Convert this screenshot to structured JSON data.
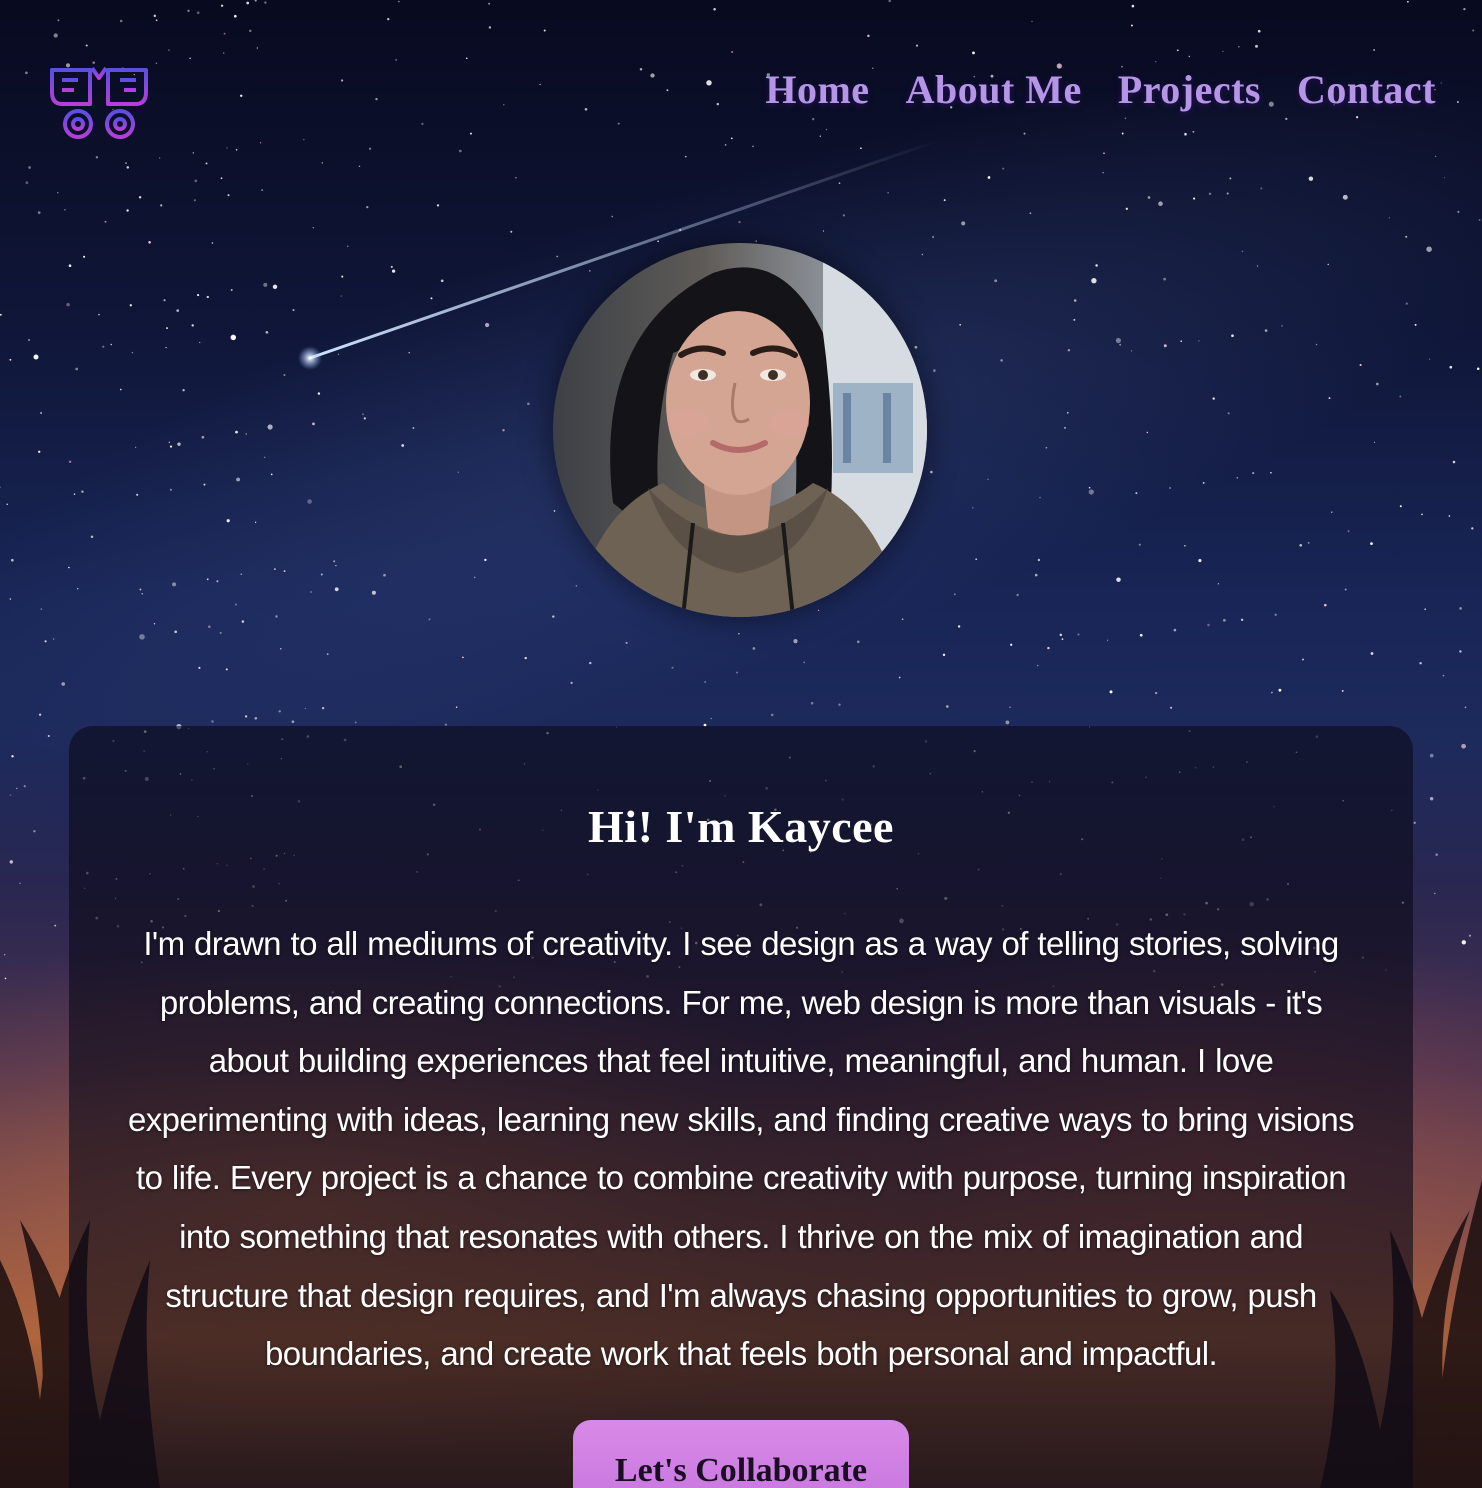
{
  "header": {
    "logo_icon": "butterfly-logo-icon",
    "nav": [
      {
        "label": "Home"
      },
      {
        "label": "About Me"
      },
      {
        "label": "Projects"
      },
      {
        "label": "Contact"
      }
    ]
  },
  "hero": {
    "portrait_icon": "profile-photo"
  },
  "about": {
    "title": "Hi! I'm Kaycee",
    "bio": "I'm drawn to all mediums of creativity. I see design as a way of telling stories, solving problems, and creating connections. For me, web design is more than visuals - it's about building experiences that feel intuitive, meaningful, and human. I love experimenting with ideas, learning new skills, and finding creative ways to bring visions to life. Every project is a chance to combine creativity with purpose, turning inspiration into something that resonates with others. I thrive on the mix of imagination and structure that design requires, and I'm always chasing opportunities to grow, push boundaries, and create work that feels both personal and impactful.",
    "cta_label": "Let's Collaborate"
  },
  "colors": {
    "nav_text": "#b595e6",
    "cta_background": "#d07ee3",
    "logo_gradient_start": "#5b4fe0",
    "logo_gradient_end": "#b53fd8"
  }
}
